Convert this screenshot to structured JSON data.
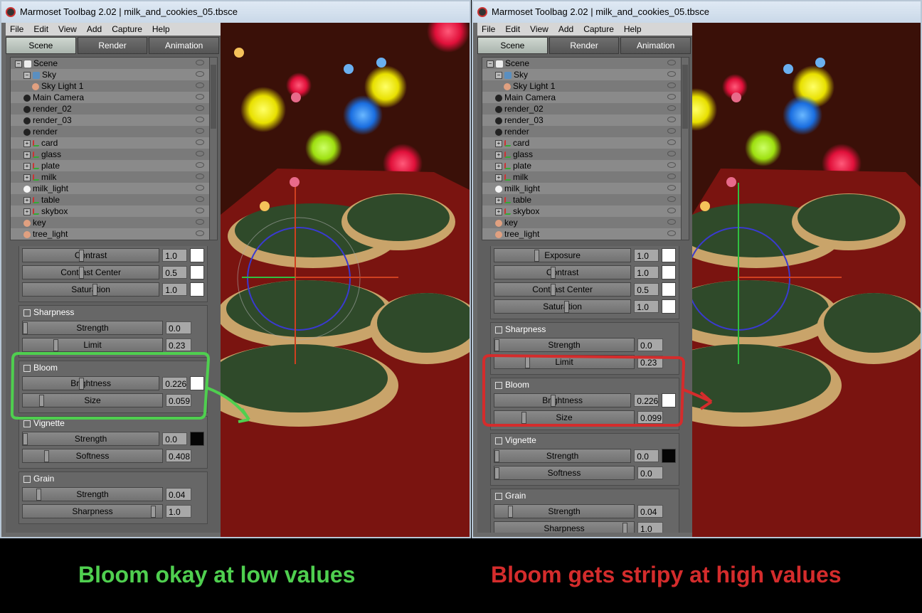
{
  "window_title": "Marmoset Toolbag 2.02  |  milk_and_cookies_05.tbsce",
  "menu": [
    "File",
    "Edit",
    "View",
    "Add",
    "Capture",
    "Help"
  ],
  "tabs": [
    "Scene",
    "Render",
    "Animation"
  ],
  "scene_tree": [
    {
      "label": "Scene",
      "icon": "scene-icon"
    },
    {
      "label": "Sky",
      "icon": "sky-icon"
    },
    {
      "label": "Sky Light 1",
      "icon": "light-icon"
    },
    {
      "label": "Main Camera",
      "icon": "camera-icon"
    },
    {
      "label": "render_02",
      "icon": "camera-icon"
    },
    {
      "label": "render_03",
      "icon": "camera-icon"
    },
    {
      "label": "render",
      "icon": "camera-icon"
    },
    {
      "label": "card",
      "icon": "mesh-icon"
    },
    {
      "label": "glass",
      "icon": "mesh-icon"
    },
    {
      "label": "plate",
      "icon": "mesh-icon"
    },
    {
      "label": "milk",
      "icon": "mesh-icon"
    },
    {
      "label": "milk_light",
      "icon": "bulb-icon"
    },
    {
      "label": "table",
      "icon": "mesh-icon"
    },
    {
      "label": "skybox",
      "icon": "mesh-icon"
    },
    {
      "label": "key",
      "icon": "light-icon"
    },
    {
      "label": "tree_light",
      "icon": "light-icon"
    }
  ],
  "left": {
    "top_props": [
      {
        "label": "Contrast",
        "value": "1.0",
        "fraction": 0.42,
        "swatch": "white"
      },
      {
        "label": "Contrast Center",
        "value": "0.5",
        "fraction": 0.42,
        "swatch": "white"
      },
      {
        "label": "Saturation",
        "value": "1.0",
        "fraction": 0.52,
        "swatch": "white"
      }
    ],
    "groups": [
      {
        "title": "Sharpness",
        "props": [
          {
            "label": "Strength",
            "value": "0.0",
            "fraction": 0.0
          },
          {
            "label": "Limit",
            "value": "0.23",
            "fraction": 0.23
          }
        ]
      },
      {
        "title": "Bloom",
        "props": [
          {
            "label": "Brightness",
            "value": "0.226",
            "fraction": 0.42,
            "swatch": "white"
          },
          {
            "label": "Size",
            "value": "0.059",
            "fraction": 0.12
          }
        ]
      },
      {
        "title": "Vignette",
        "props": [
          {
            "label": "Strength",
            "value": "0.0",
            "fraction": 0.0,
            "swatch": "black"
          },
          {
            "label": "Softness",
            "value": "0.408",
            "fraction": 0.16
          }
        ]
      },
      {
        "title": "Grain",
        "props": [
          {
            "label": "Strength",
            "value": "0.04",
            "fraction": 0.1
          },
          {
            "label": "Sharpness",
            "value": "1.0",
            "fraction": 0.96
          }
        ]
      }
    ]
  },
  "right": {
    "top_props": [
      {
        "label": "Exposure",
        "value": "1.0",
        "fraction": 0.3,
        "swatch": "white"
      },
      {
        "label": "Contrast",
        "value": "1.0",
        "fraction": 0.42,
        "swatch": "white"
      },
      {
        "label": "Contrast Center",
        "value": "0.5",
        "fraction": 0.42,
        "swatch": "white"
      },
      {
        "label": "Saturation",
        "value": "1.0",
        "fraction": 0.52,
        "swatch": "white"
      }
    ],
    "groups": [
      {
        "title": "Sharpness",
        "props": [
          {
            "label": "Strength",
            "value": "0.0",
            "fraction": 0.0
          },
          {
            "label": "Limit",
            "value": "0.23",
            "fraction": 0.23
          }
        ]
      },
      {
        "title": "Bloom",
        "props": [
          {
            "label": "Brightness",
            "value": "0.226",
            "fraction": 0.42,
            "swatch": "white"
          },
          {
            "label": "Size",
            "value": "0.099",
            "fraction": 0.2
          }
        ]
      },
      {
        "title": "Vignette",
        "props": [
          {
            "label": "Strength",
            "value": "0.0",
            "fraction": 0.0,
            "swatch": "black"
          },
          {
            "label": "Softness",
            "value": "0.0",
            "fraction": 0.0
          }
        ]
      },
      {
        "title": "Grain",
        "props": [
          {
            "label": "Strength",
            "value": "0.04",
            "fraction": 0.1
          },
          {
            "label": "Sharpness",
            "value": "1.0",
            "fraction": 0.96
          }
        ]
      }
    ]
  },
  "captions": {
    "left": "Bloom okay at low values",
    "right": "Bloom gets stripy at high values"
  },
  "colors": {
    "annotation_green": "#4fcf4f",
    "annotation_red": "#d42c2c"
  }
}
